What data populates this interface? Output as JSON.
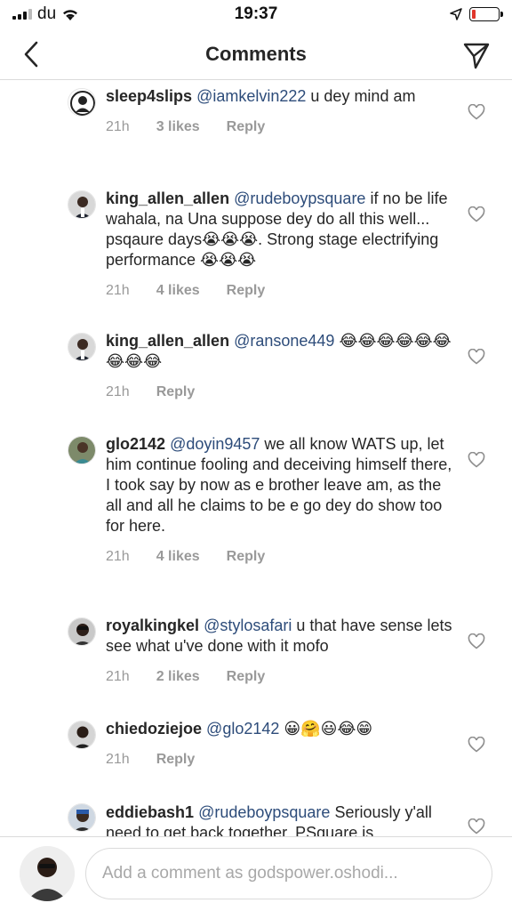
{
  "status_bar": {
    "carrier": "du",
    "time": "19:37"
  },
  "nav": {
    "title": "Comments"
  },
  "comments": [
    {
      "user": "sleep4slips",
      "mention": "@iamkelvin222",
      "text": " u dey mind am",
      "time": "21h",
      "likes": "3 likes",
      "reply": "Reply"
    },
    {
      "user": "king_allen_allen",
      "mention": "@rudeboypsquare",
      "text": " if no be life wahala, na Una suppose dey do all this well... psqaure days😭😭😭. Strong stage electrifying performance 😭😭😭",
      "time": "21h",
      "likes": "4 likes",
      "reply": "Reply"
    },
    {
      "user": "king_allen_allen",
      "mention": "@ransone449",
      "text": " 😂😂😂😂😂😂😂😂😂",
      "time": "21h",
      "likes": "",
      "reply": "Reply"
    },
    {
      "user": "glo2142",
      "mention": "@doyin9457",
      "text": " we all know WATS up, let him continue fooling and deceiving himself there,  I took say by now as e brother leave am, as the all and all he claims to be e go dey do show too for here.",
      "time": "21h",
      "likes": "4 likes",
      "reply": "Reply"
    },
    {
      "user": "royalkingkel",
      "mention": "@stylosafari",
      "text": " u that have sense lets see what u've done with it mofo",
      "time": "21h",
      "likes": "2 likes",
      "reply": "Reply"
    },
    {
      "user": "chiedoziejoe",
      "mention": "@glo2142",
      "text": " 😀🤗😃😂😁",
      "time": "21h",
      "likes": "",
      "reply": "Reply"
    },
    {
      "user": "eddiebash1",
      "mention": "@rudeboypsquare",
      "text": " Seriously y'all need to get back together. PSquare is",
      "time": "",
      "likes": "",
      "reply": ""
    }
  ],
  "compose": {
    "placeholder": "Add a comment as godspower.oshodi..."
  },
  "icons": {
    "back": "chevron-left-icon",
    "send": "paper-plane-icon",
    "heart": "heart-outline-icon",
    "location": "location-arrow-icon",
    "wifi": "wifi-icon",
    "battery": "battery-icon"
  },
  "colors": {
    "mention": "#2d4c7a",
    "meta": "#999999",
    "battery_low": "#e0372c"
  }
}
